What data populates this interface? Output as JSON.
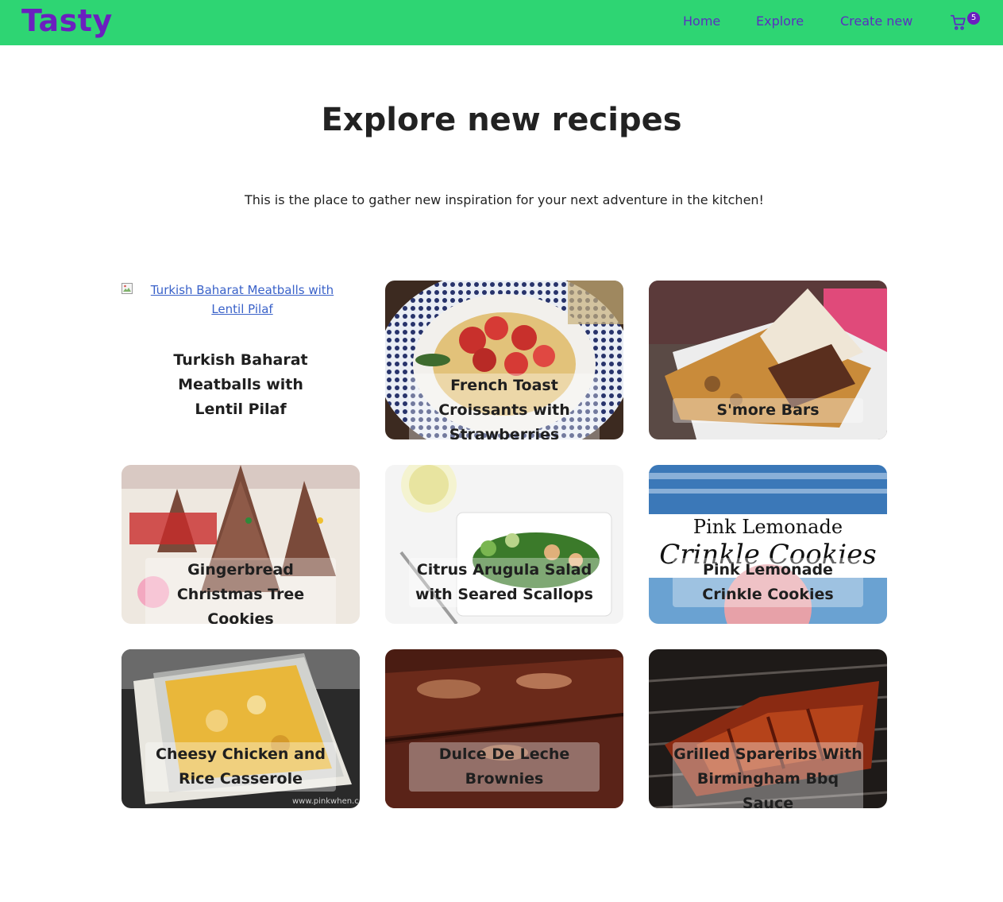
{
  "nav": {
    "logo": "Tasty",
    "links": [
      "Home",
      "Explore",
      "Create new"
    ],
    "cart_count": "5",
    "cart_icon": "cart-icon"
  },
  "hero": {
    "title": "Explore new recipes",
    "subtitle": "This is the place to gather new inspiration for your next adventure in the kitchen!"
  },
  "recipes": [
    {
      "title": "Turkish Baharat Meatballs with Lentil Pilaf",
      "image_alt": "Turkish Baharat Meatballs with Lentil Pilaf",
      "image_loaded": false
    },
    {
      "title": "French Toast Croissants with Strawberries"
    },
    {
      "title": "S'more Bars"
    },
    {
      "title": "Gingerbread Christmas Tree Cookies"
    },
    {
      "title": "Citrus Arugula Salad with Seared Scallops"
    },
    {
      "title": "Pink Lemonade Crinkle Cookies",
      "image_text": "Pink Lemonade Crinkle Cookies"
    },
    {
      "title": "Cheesy Chicken and Rice Casserole",
      "image_watermark": "www.pinkwhen.com"
    },
    {
      "title": "Dulce De Leche Brownies"
    },
    {
      "title": "Grilled Spareribs With Birmingham Bbq Sauce"
    }
  ],
  "colors": {
    "navbar": "#2ed573",
    "brand": "#6b1fbf",
    "nav_link": "#5a2fc0"
  }
}
